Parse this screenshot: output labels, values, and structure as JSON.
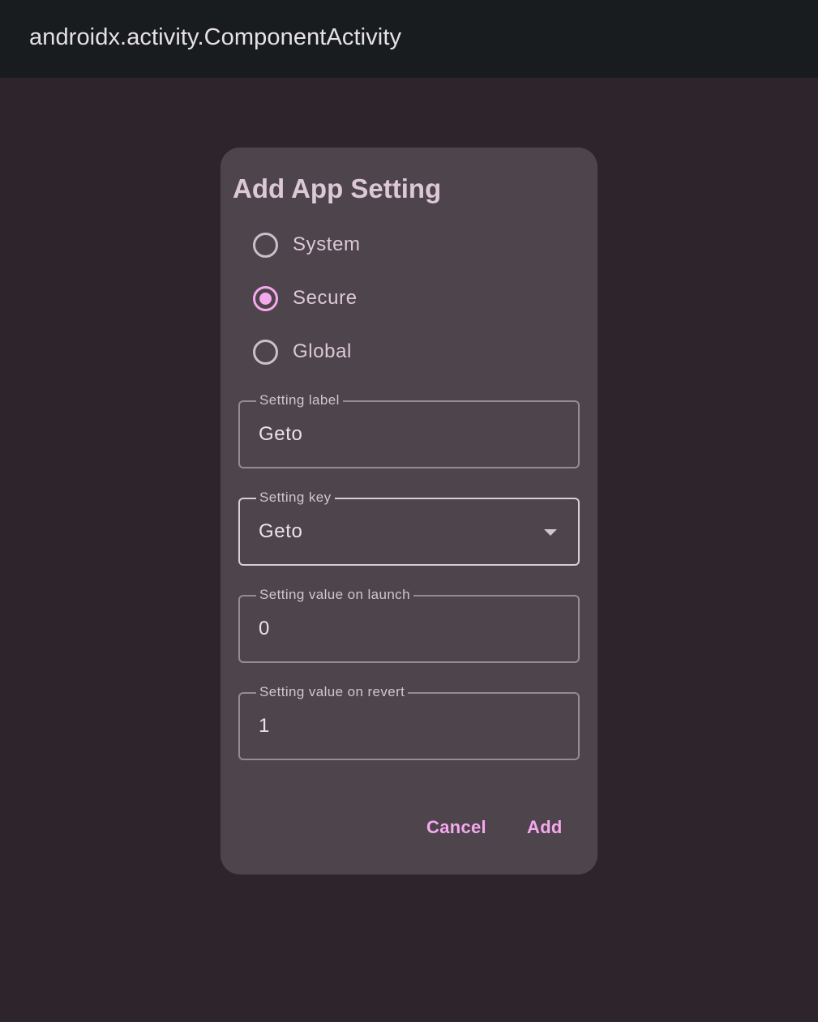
{
  "appbar": {
    "title": "androidx.activity.ComponentActivity"
  },
  "dialog": {
    "title": "Add App Setting",
    "radio_options": [
      {
        "label": "System",
        "checked": false
      },
      {
        "label": "Secure",
        "checked": true
      },
      {
        "label": "Global",
        "checked": false
      }
    ],
    "fields": {
      "label": {
        "label": "Setting label",
        "value": "Geto"
      },
      "key": {
        "label": "Setting key",
        "value": "Geto"
      },
      "launch": {
        "label": "Setting value on launch",
        "value": "0"
      },
      "revert": {
        "label": "Setting value on revert",
        "value": "1"
      }
    },
    "buttons": {
      "cancel": "Cancel",
      "add": "Add"
    }
  },
  "colors": {
    "background": "#2e242b",
    "appbar": "#191c1f",
    "dialog": "#4e444c",
    "accent": "#f6a8ee"
  }
}
